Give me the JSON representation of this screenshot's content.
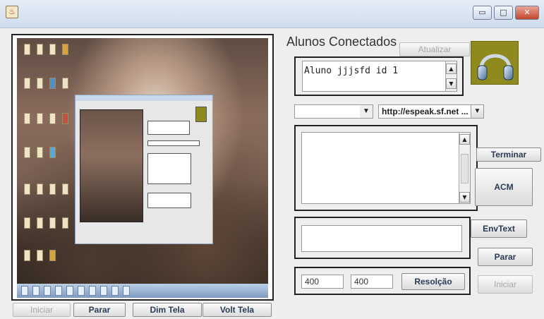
{
  "window": {
    "controls": {
      "minimize": "▭",
      "maximize": "□",
      "close": "✕"
    }
  },
  "preview": {
    "buttons": {
      "start": "Iniciar",
      "stop": "Parar",
      "dim_screen": "Dim Tela",
      "volt_screen": "Volt Tela"
    }
  },
  "students": {
    "title": "Alunos Conectados",
    "refresh_label": "Atualizar",
    "list_items": [
      "Aluno jjjsfd id 1"
    ]
  },
  "voice": {
    "selected_voice": "",
    "url_value": "http://espeak.sf.net ..."
  },
  "actions": {
    "finish_label": "Terminar",
    "acm_label": "ACM",
    "send_text_label": "EnvText",
    "stop_label": "Parar",
    "start_label": "Iniciar",
    "resolution_label": "Resolção"
  },
  "resolution": {
    "width": "400",
    "height": "400"
  },
  "icons": {
    "app": "java-icon",
    "headphones": "headphones-icon"
  }
}
